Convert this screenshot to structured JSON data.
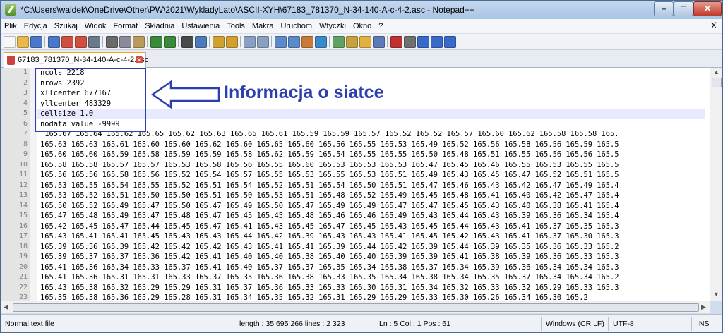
{
  "window": {
    "title": "*C:\\Users\\waldek\\OneDrive\\Other\\PW\\2021\\WykladyLato\\ASCII-XYH\\67183_781370_N-34-140-A-c-4-2.asc - Notepad++",
    "min_glyph": "–",
    "max_glyph": "□",
    "close_glyph": "✕"
  },
  "menu": {
    "items": [
      "Plik",
      "Edycja",
      "Szukaj",
      "Widok",
      "Format",
      "Składnia",
      "Ustawienia",
      "Tools",
      "Makra",
      "Uruchom",
      "Wtyczki",
      "Okno",
      "?"
    ],
    "close_glyph": "X"
  },
  "toolbar": {
    "icons": [
      "new-file-icon",
      "open-file-icon",
      "save-icon",
      "save-all-icon",
      "close-icon",
      "close-all-icon",
      "print-icon",
      "cut-icon",
      "copy-icon",
      "paste-icon",
      "undo-icon",
      "redo-icon",
      "find-icon",
      "replace-icon",
      "zoom-in-icon",
      "zoom-out-icon",
      "sync-v-icon",
      "sync-h-icon",
      "word-wrap-icon",
      "all-chars-icon",
      "indent-guide-icon",
      "udl-icon",
      "doc-map-icon",
      "function-list-icon",
      "folder-workspace-icon",
      "monitor-icon",
      "record-macro-icon",
      "stop-macro-icon",
      "play-macro-icon",
      "run-macro-multiple-icon",
      "save-macro-icon"
    ]
  },
  "tab": {
    "label": "67183_781370_N-34-140-A-c-4-2.asc",
    "close_glyph": "✕"
  },
  "editor": {
    "lines": [
      {
        "n": "1",
        "text": "ncols 2218"
      },
      {
        "n": "2",
        "text": "nrows 2392"
      },
      {
        "n": "3",
        "text": "xllcenter 677167"
      },
      {
        "n": "4",
        "text": "yllcenter 483329"
      },
      {
        "n": "5",
        "text": "cellsize 1.0"
      },
      {
        "n": "6",
        "text": "nodata_value -9999"
      },
      {
        "n": "7",
        "text": " 165.67 165.64 165.62 165.65 165.62 165.63 165.65 165.61 165.59 165.59 165.57 165.52 165.52 165.57 165.60 165.62 165.58 165.58 165."
      },
      {
        "n": "8",
        "text": "165.63 165.63 165.61 165.60 165.60 165.62 165.60 165.65 165.60 165.56 165.55 165.53 165.49 165.52 165.56 165.58 165.56 165.59 165.5"
      },
      {
        "n": "9",
        "text": "165.60 165.60 165.59 165.58 165.59 165.59 165.58 165.62 165.59 165.54 165.55 165.55 165.50 165.48 165.51 165.55 165.56 165.56 165.5"
      },
      {
        "n": "10",
        "text": "165.58 165.58 165.57 165.57 165.53 165.58 165.56 165.55 165.60 165.53 165.53 165.53 165.47 165.45 165.46 165.55 165.53 165.55 165.5"
      },
      {
        "n": "11",
        "text": "165.56 165.56 165.58 165.56 165.52 165.54 165.57 165.55 165.53 165.55 165.53 165.51 165.49 165.43 165.45 165.47 165.52 165.51 165.5"
      },
      {
        "n": "12",
        "text": "165.53 165.55 165.54 165.55 165.52 165.51 165.54 165.52 165.51 165.54 165.50 165.51 165.47 165.46 165.43 165.42 165.47 165.49 165.4"
      },
      {
        "n": "13",
        "text": "165.53 165.52 165.51 165.50 165.50 165.51 165.50 165.53 165.51 165.48 165.52 165.49 165.45 165.48 165.41 165.40 165.42 165.47 165.4"
      },
      {
        "n": "14",
        "text": "165.50 165.52 165.49 165.47 165.50 165.47 165.49 165.50 165.47 165.49 165.49 165.47 165.47 165.45 165.43 165.40 165.38 165.41 165.4"
      },
      {
        "n": "15",
        "text": "165.47 165.48 165.49 165.47 165.48 165.47 165.45 165.45 165.48 165.46 165.46 165.49 165.43 165.44 165.43 165.39 165.36 165.34 165.4"
      },
      {
        "n": "16",
        "text": "165.42 165.45 165.47 165.44 165.45 165.47 165.41 165.43 165.45 165.47 165.45 165.43 165.45 165.44 165.43 165.41 165.37 165.35 165.3"
      },
      {
        "n": "17",
        "text": "165.43 165.41 165.41 165.45 165.43 165.43 165.44 165.42 165.39 165.43 165.43 165.41 165.45 165.42 165.43 165.41 165.37 165.30 165.3"
      },
      {
        "n": "18",
        "text": "165.39 165.36 165.39 165.42 165.42 165.42 165.43 165.41 165.41 165.39 165.44 165.42 165.39 165.44 165.39 165.35 165.36 165.33 165.2"
      },
      {
        "n": "19",
        "text": "165.39 165.37 165.37 165.36 165.42 165.41 165.40 165.40 165.38 165.40 165.40 165.39 165.39 165.41 165.38 165.39 165.36 165.33 165.3"
      },
      {
        "n": "20",
        "text": "165.41 165.36 165.34 165.33 165.37 165.41 165.40 165.37 165.37 165.35 165.34 165.38 165.37 165.34 165.39 165.36 165.34 165.34 165.3"
      },
      {
        "n": "21",
        "text": "165.41 165.36 165.31 165.31 165.33 165.37 165.35 165.36 165.38 165.33 165.35 165.34 165.38 165.34 165.35 165.37 165.34 165.34 165.2"
      },
      {
        "n": "22",
        "text": "165.43 165.38 165.32 165.29 165.29 165.31 165.37 165.36 165.33 165.33 165.30 165.31 165.34 165.32 165.33 165.32 165.29 165.33 165.3"
      },
      {
        "n": "23",
        "text": "165.35 165.38 165.36 165.29 165.28 165.31 165.34 165.35 165.32 165.31 165.29 165.29 165.33 165.30 165.26 165.34 165.30 165.2"
      }
    ],
    "current_line_index": 4
  },
  "annotation": {
    "label": "Informacja o siatce",
    "color": "#2b3fae"
  },
  "status": {
    "file_type": "Normal text file",
    "length_lines": "length : 35 695 266    lines : 2 323",
    "position": "Ln : 5    Col : 1    Pos : 61",
    "eol": "Windows (CR LF)",
    "encoding": "UTF-8",
    "mode": "INS"
  }
}
